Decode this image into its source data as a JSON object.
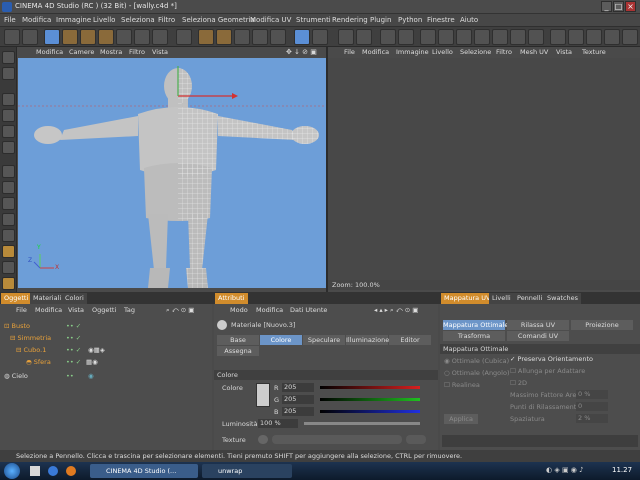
{
  "window": {
    "title": "CINEMA 4D Studio (RC ) (32 Bit) - [wally.c4d *]"
  },
  "menubar": {
    "items": [
      "File",
      "Modifica",
      "Immagine",
      "Livello",
      "Seleziona",
      "Filtro",
      "Seleziona Geometria",
      "Modifica UV",
      "Strumenti",
      "Rendering",
      "Plugin",
      "Python",
      "Finestre",
      "Aiuto"
    ]
  },
  "viewport": {
    "menu": [
      "Modifica",
      "Camere",
      "Mostra",
      "Filtro",
      "Vista"
    ],
    "axis_labels": {
      "y": "Y",
      "z": "Z",
      "x": "X"
    }
  },
  "uv_editor": {
    "menu": [
      "File",
      "Modifica",
      "Immagine",
      "Livello",
      "Selezione",
      "Filtro",
      "Mesh UV",
      "Vista",
      "Texture"
    ],
    "zoom": "Zoom: 100.0%"
  },
  "object_manager": {
    "tabs": [
      "Oggetti",
      "Materiali",
      "Colori"
    ],
    "menu": [
      "File",
      "Modifica",
      "Vista",
      "Oggetti",
      "Tag"
    ],
    "objects": [
      {
        "name": "Busto",
        "color": "#e8a13a"
      },
      {
        "name": "Simmetria",
        "color": "#e8a13a"
      },
      {
        "name": "Cubo.1",
        "color": "#e8a13a"
      },
      {
        "name": "Sfera",
        "color": "#e8a13a"
      },
      {
        "name": "Cielo",
        "color": "#dddddd"
      }
    ]
  },
  "attributes": {
    "tab": "Attributi",
    "menu": [
      "Modo",
      "Modifica",
      "Dati Utente"
    ],
    "material_title": "Materiale [Nuovo.3]",
    "channel_buttons": [
      "Base",
      "Colore",
      "Speculare",
      "Illuminazione",
      "Editor"
    ],
    "channel_buttons2": [
      "Assegna"
    ],
    "section": "Colore",
    "color_label": "Colore",
    "r": {
      "label": "R",
      "value": "205"
    },
    "g": {
      "label": "G",
      "value": "205"
    },
    "b": {
      "label": "B",
      "value": "205"
    },
    "luminosity": {
      "label": "Luminosità",
      "value": "100 %"
    },
    "texture_label": "Texture"
  },
  "uv_manager": {
    "tabs": [
      "Mappatura UV",
      "Livelli",
      "Pennelli",
      "Swatches"
    ],
    "subtabs": [
      "Mappatura Ottimale",
      "Rilassa UV",
      "Proiezione"
    ],
    "subtabs2": [
      "Trasforma",
      "Comandi UV"
    ],
    "section": "Mappatura Ottimale",
    "options_left": [
      "Ottimale (Cubica)",
      "Ottimale (Angolo)",
      "Realinea"
    ],
    "options_right": [
      "Preserva Orientamento",
      "Allunga per Adattare",
      "2D"
    ],
    "fields": [
      {
        "label": "Massimo Fattore Area",
        "value": "0 %"
      },
      {
        "label": "Punti di Rilassamento",
        "value": "0"
      },
      {
        "label": "Spaziatura",
        "value": "2 %"
      }
    ],
    "apply": "Applica"
  },
  "statusbar": {
    "text": "Selezione a Pennello. Clicca e trascina per selezionare elementi. Tieni premuto SHIFT per aggiungere alla selezione, CTRL per rimuovere."
  },
  "taskbar": {
    "items": [
      "CINEMA 4D Studio (...",
      "unwrap"
    ],
    "time": "11.27"
  },
  "colors": {
    "accent": "#d18c2c",
    "viewport_bg": "#6d9ed8",
    "selection": "#6c95c8"
  }
}
